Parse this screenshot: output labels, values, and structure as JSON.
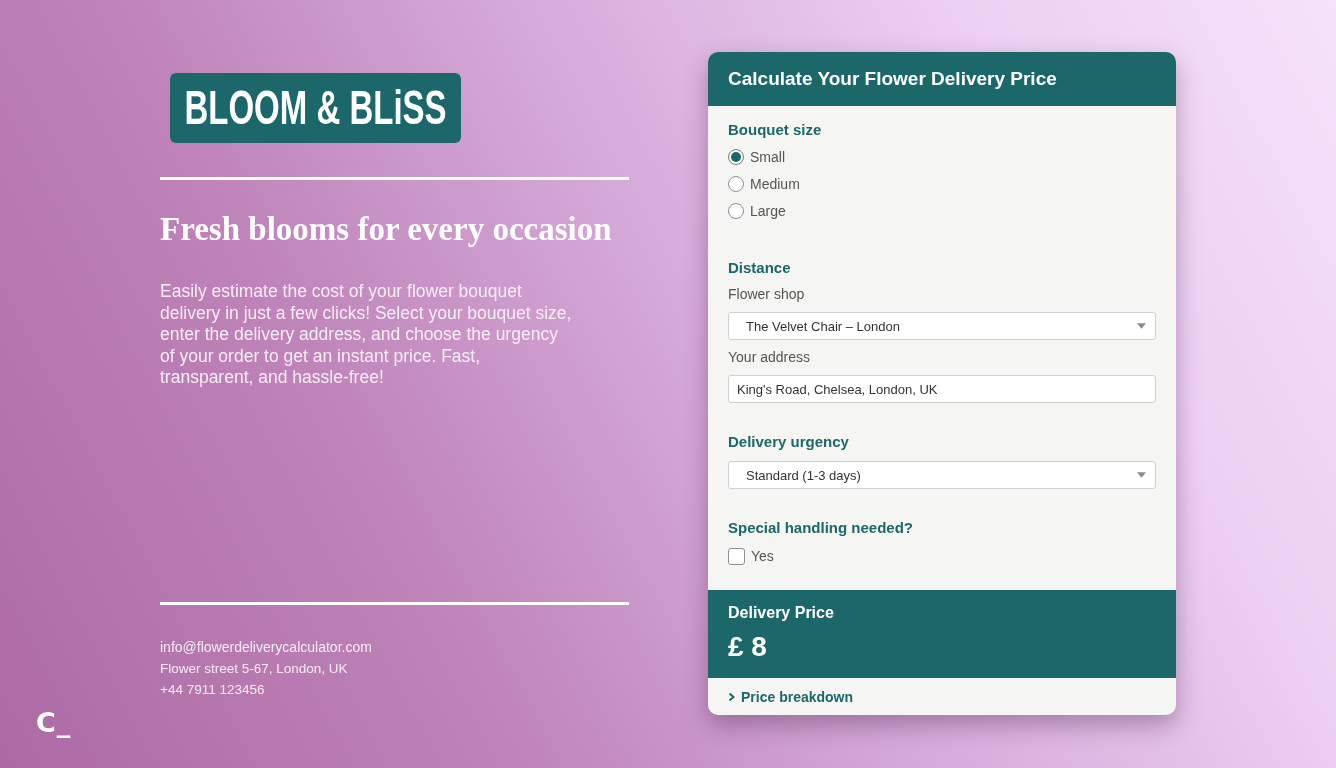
{
  "brand": {
    "logo_text": "BLOOM & BLiSS"
  },
  "hero": {
    "heading": "Fresh blooms for every occasion",
    "description": "Easily estimate the cost of your flower bouquet delivery in just a few clicks! Select your bouquet size, enter the delivery address, and choose the urgency of your order to get an instant price. Fast, transparent, and hassle-free!"
  },
  "contact": {
    "email": "info@flowerdeliverycalculator.com",
    "address": "Flower street 5-67, London, UK",
    "phone": "+44 7911 123456"
  },
  "corner_logo": "C_",
  "calculator": {
    "title": "Calculate Your Flower Delivery Price",
    "sections": [
      {
        "kind": "radio",
        "label": "Bouquet size",
        "options": [
          {
            "label": "Small",
            "selected": true
          },
          {
            "label": "Medium",
            "selected": false
          },
          {
            "label": "Large",
            "selected": false
          }
        ]
      },
      {
        "kind": "fields",
        "label": "Distance",
        "fields": [
          {
            "kind": "select",
            "label": "Flower shop",
            "value": "The Velvet Chair – London"
          },
          {
            "kind": "input",
            "label": "Your address",
            "value": "King's Road, Chelsea, London, UK"
          }
        ]
      },
      {
        "kind": "fields",
        "label": "Delivery urgency",
        "fields": [
          {
            "kind": "select",
            "value": "Standard (1-3 days)"
          }
        ]
      },
      {
        "kind": "checkbox",
        "label": "Special handling needed?",
        "options": [
          {
            "label": "Yes",
            "checked": false
          }
        ]
      }
    ],
    "price": {
      "label": "Delivery Price",
      "value": "£ 8"
    },
    "breakdown": {
      "label": "Price breakdown",
      "expanded": false
    }
  }
}
